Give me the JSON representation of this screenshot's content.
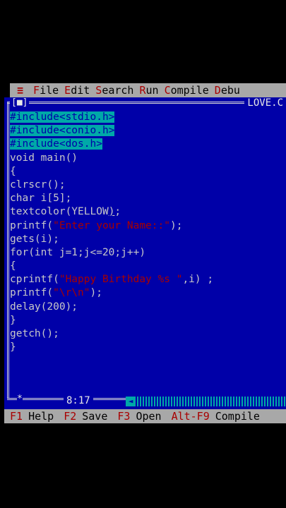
{
  "menu": {
    "system": "≡",
    "items": [
      {
        "hot": "F",
        "rest": "ile"
      },
      {
        "hot": "E",
        "rest": "dit"
      },
      {
        "hot": "S",
        "rest": "earch"
      },
      {
        "hot": "R",
        "rest": "un"
      },
      {
        "hot": "C",
        "rest": "ompile"
      },
      {
        "hot": "D",
        "rest": "ebu"
      }
    ]
  },
  "window": {
    "close": "[■]",
    "filename": "LOVE.C"
  },
  "code": {
    "l1": "#include<stdio.h>",
    "l2": "#include<conio.h>",
    "l3": "#include<dos.h>",
    "l4": "void main()",
    "l5": "{",
    "l6": "clrscr();",
    "l7": "char i[5];",
    "l8a": "textcolor(YELLOW",
    "l8b": ")",
    "l8c": ";",
    "l9a": "printf(",
    "l9b": "\"Enter your Name::\"",
    "l9c": ");",
    "l10": "gets(i);",
    "l11": "for(int j=1;j<=20;j++)",
    "l12": "{",
    "l13a": "cprintf(",
    "l13b": "\"Happy Birthday %s \"",
    "l13c": ",i) ;",
    "l14a": "printf(",
    "l14b": "\"\\r\\n\"",
    "l14c": ");",
    "l15": "delay(200);",
    "l16": "}",
    "l17": "getch();",
    "l18": "}"
  },
  "status": {
    "star": "*",
    "position": "8:17"
  },
  "fkeys": [
    {
      "key": "F1",
      "label": "Help"
    },
    {
      "key": "F2",
      "label": "Save"
    },
    {
      "key": "F3",
      "label": "Open"
    },
    {
      "key": "Alt-F9",
      "label": "Compile"
    }
  ],
  "colors": {
    "editor_bg": "#0000a8",
    "menu_bg": "#a8a8a8",
    "hotkey": "#a80000",
    "selection": "#00a8a8"
  }
}
